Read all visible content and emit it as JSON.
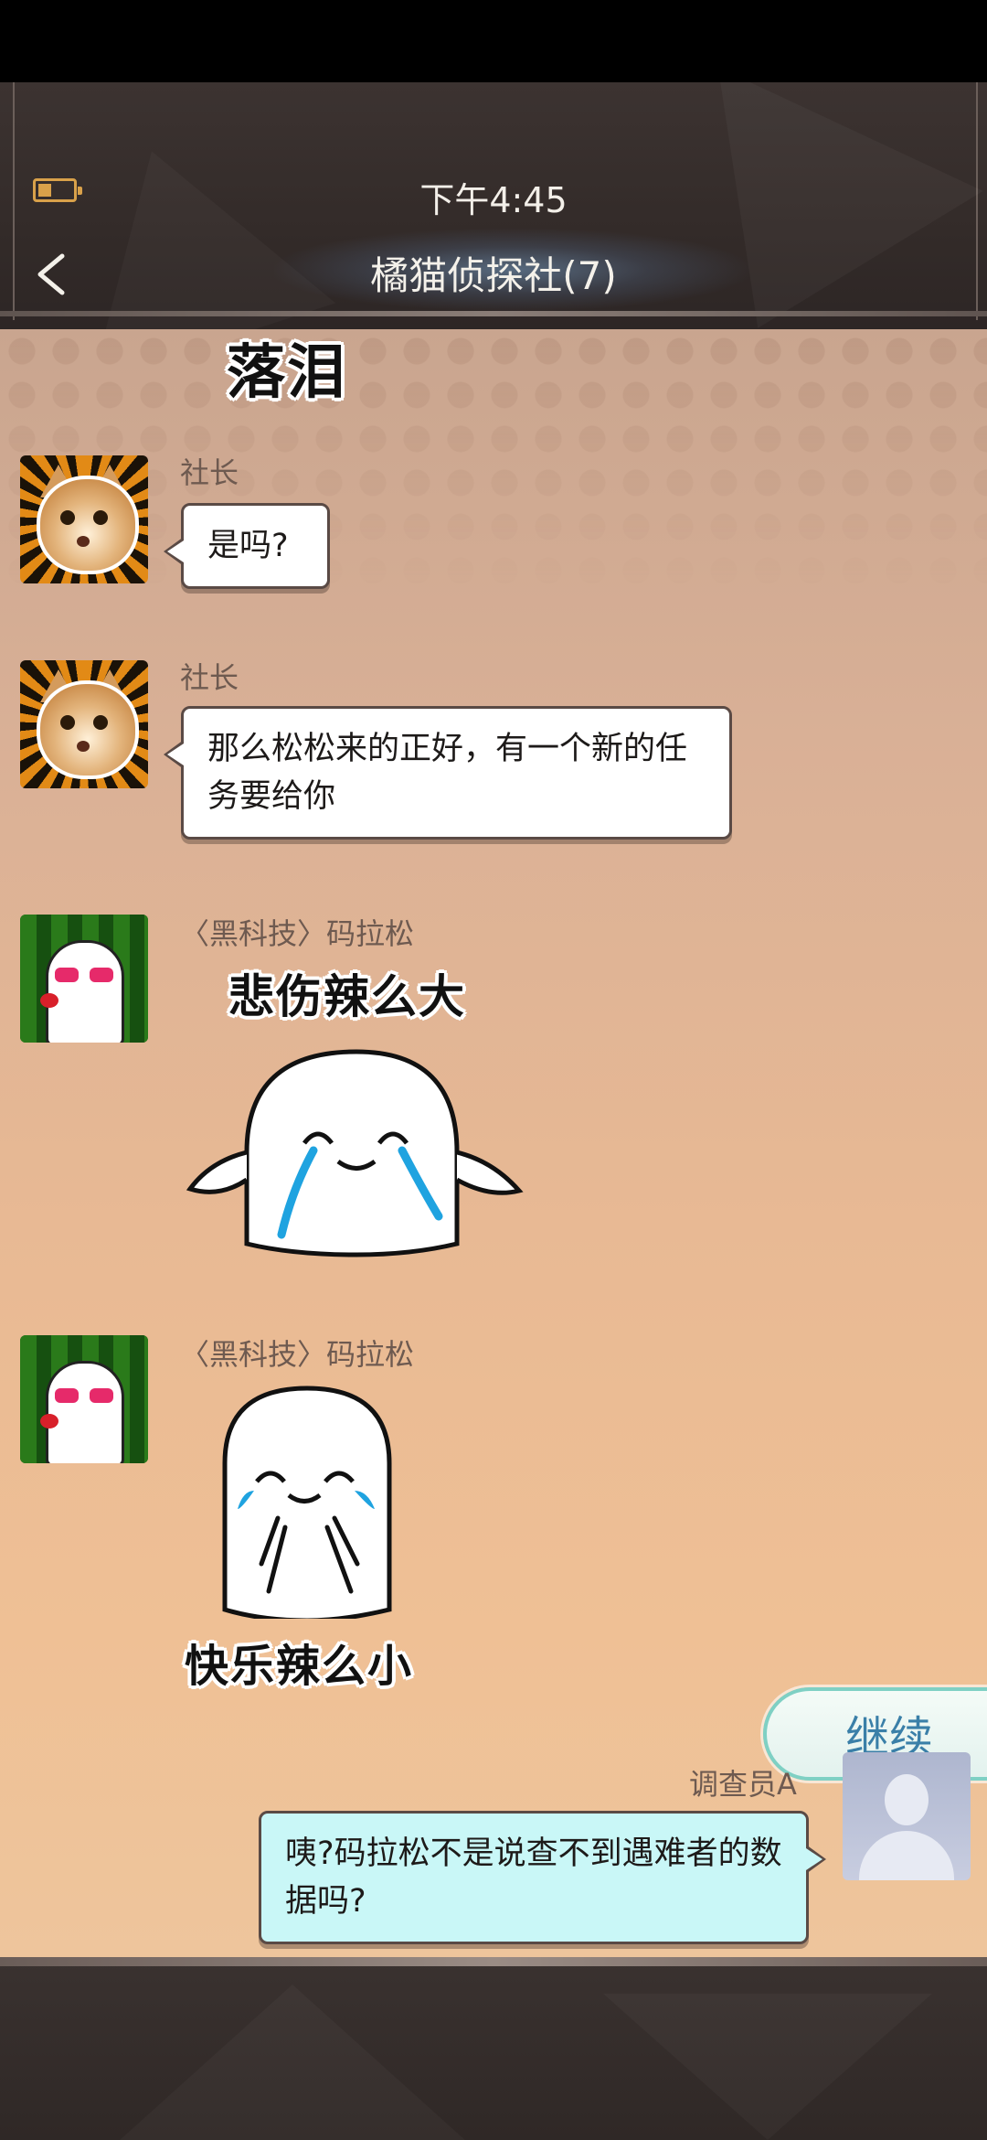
{
  "status_bar": {
    "time": "下午4:45",
    "battery": "battery-low"
  },
  "header": {
    "title": "橘猫侦探社(7)",
    "back_icon": "back-chevron-icon"
  },
  "chat": {
    "top_sticker_fragment": "落泪",
    "messages": [
      {
        "sender": "社长",
        "avatar": "cat-avatar",
        "text": "是吗?"
      },
      {
        "sender": "社长",
        "avatar": "cat-avatar",
        "text": "那么松松来的正好，有一个新的任务要给你"
      },
      {
        "sender": "〈黑科技〉码拉松",
        "avatar": "ghost-avatar",
        "sticker_text": "悲伤辣么大"
      },
      {
        "sender": "〈黑科技〉码拉松",
        "avatar": "ghost-avatar",
        "sticker_text": "快乐辣么小"
      },
      {
        "sender": "调查员A",
        "avatar": "default-user-avatar",
        "text": "咦?码拉松不是说查不到遇难者的数据吗?"
      }
    ]
  },
  "continue_button": {
    "label": "继续"
  },
  "colors": {
    "accent_continue": "#3a7fa8",
    "my_bubble": "#c9f7f7",
    "header_bg": "#3c3331"
  }
}
